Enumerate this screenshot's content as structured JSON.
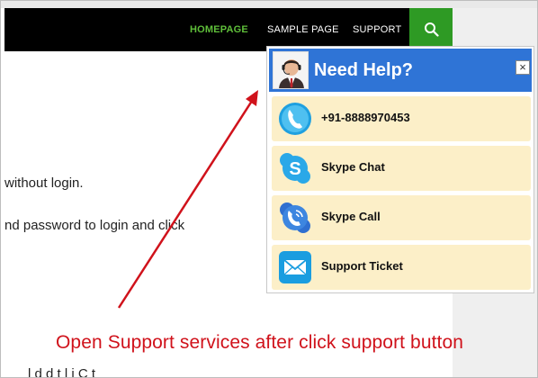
{
  "nav": {
    "items": [
      {
        "label": "HOMEPAGE",
        "active": true
      },
      {
        "label": "SAMPLE PAGE",
        "active": false
      },
      {
        "label": "SUPPORT",
        "active": false
      }
    ],
    "search_icon": "search-icon"
  },
  "content": {
    "line1": "without login.",
    "line2": "nd password to login and click",
    "line3": "l     d    d t  l  i  C t"
  },
  "help_widget": {
    "title": "Need Help?",
    "close_label": "×",
    "options": [
      {
        "label": "+91-8888970453",
        "icon": "phone-icon"
      },
      {
        "label": "Skype Chat",
        "icon": "skype-icon"
      },
      {
        "label": "Skype Call",
        "icon": "skype-call-icon"
      },
      {
        "label": "Support Ticket",
        "icon": "envelope-icon"
      }
    ]
  },
  "annotation": {
    "text": "Open Support services after click support button"
  },
  "colors": {
    "nav_bg": "#000000",
    "nav_active": "#5fbf3a",
    "search_bg": "#2e9a24",
    "help_header": "#2f74d6",
    "option_bg": "#fcefc8",
    "annotation": "#d0121b"
  }
}
